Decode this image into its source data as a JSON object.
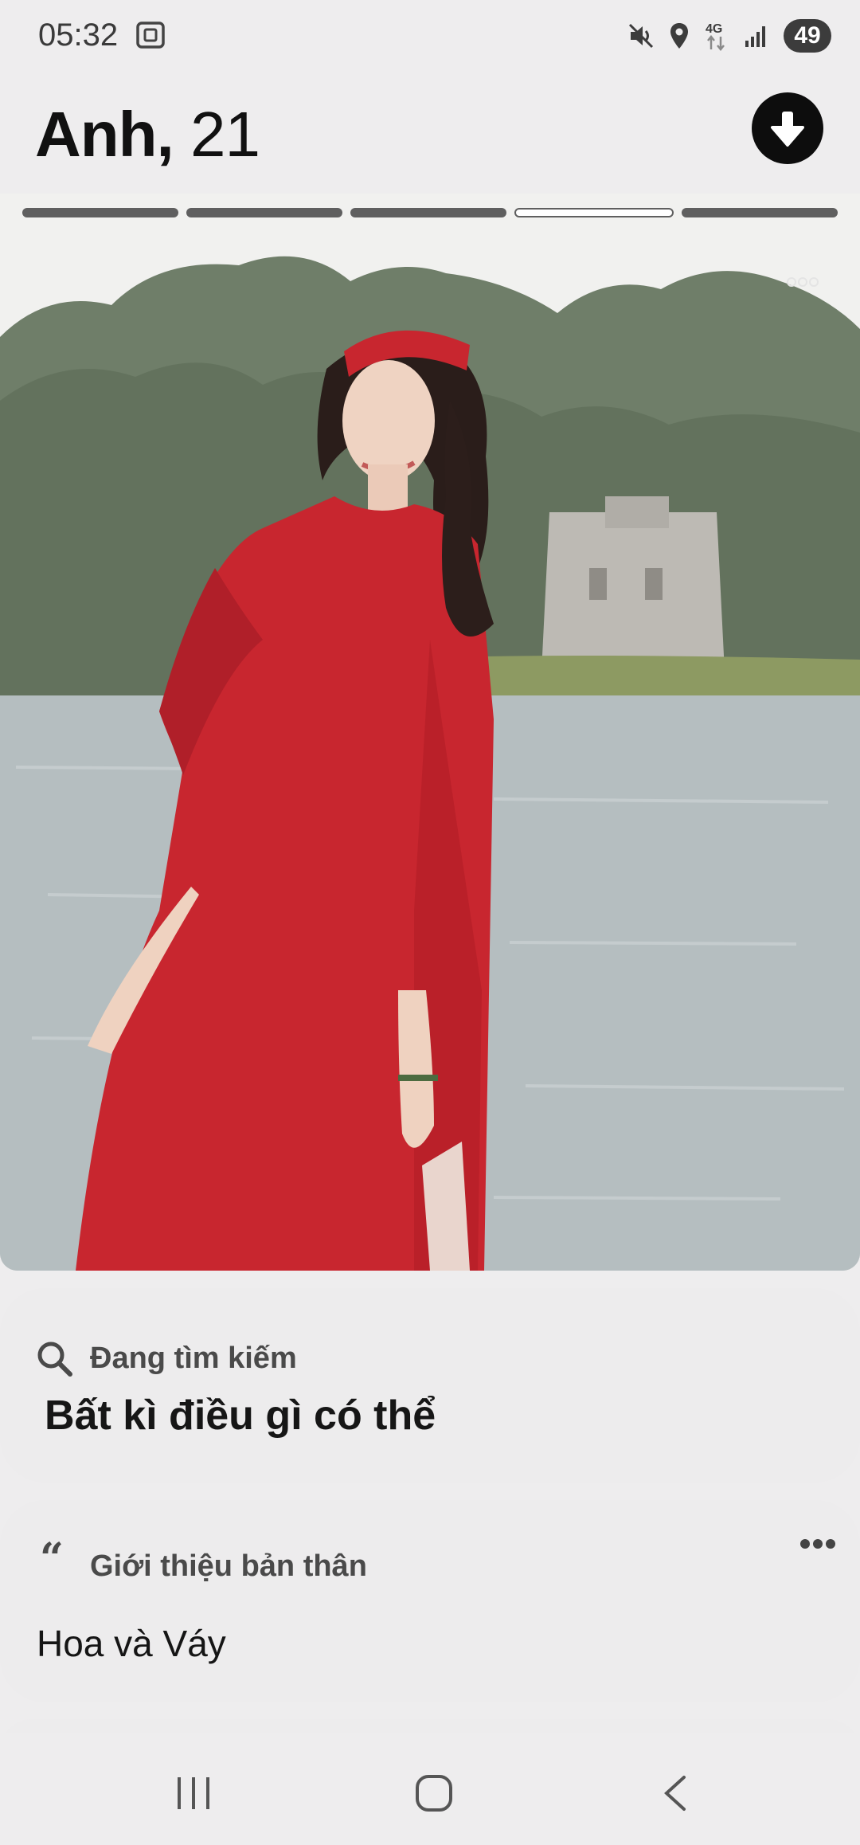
{
  "status_bar": {
    "time": "05:32",
    "network": "4G",
    "battery": "49",
    "icons": [
      "screenshot-icon",
      "mute-icon",
      "location-icon",
      "network-4g-icon",
      "signal-icon",
      "battery-icon"
    ]
  },
  "header": {
    "name": "Anh,",
    "age": "21",
    "action_icon": "arrow-down-icon"
  },
  "photo": {
    "segments": 5,
    "active_segment": 4,
    "menu_icon": "more-icon"
  },
  "looking_for": {
    "label": "Đang tìm kiếm",
    "value": "Bất kì điều gì có thể",
    "icon": "search-icon"
  },
  "about": {
    "label": "Giới thiệu bản thân",
    "value": "Hoa và Váy",
    "icon": "quote-icon",
    "menu_icon": "more-icon"
  },
  "navigation": {
    "buttons": [
      "recent-apps",
      "home",
      "back"
    ]
  },
  "colors": {
    "background": "#eeedee",
    "card": "#edeced",
    "button_dark": "#0d0d0d",
    "dress_red": "#c8262f",
    "progress": "#5f5f5f"
  }
}
